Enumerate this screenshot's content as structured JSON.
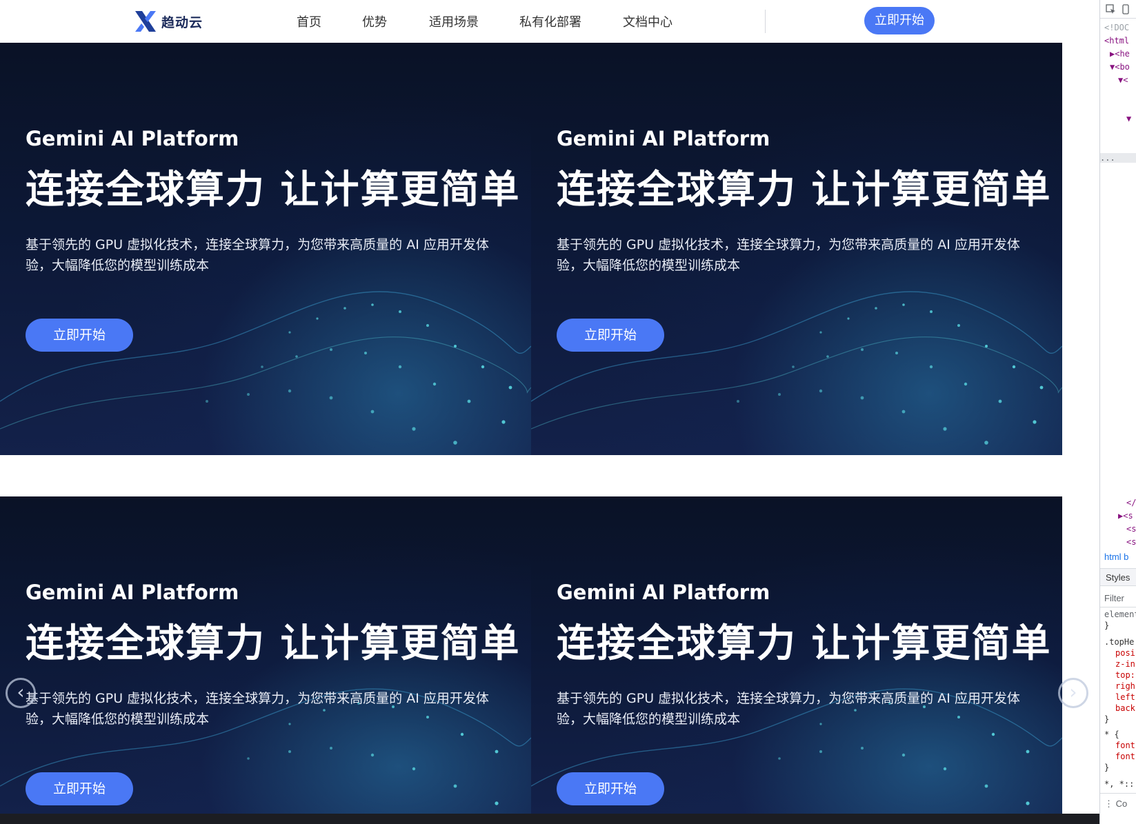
{
  "header": {
    "logo_text": "趋动云",
    "nav": [
      "首页",
      "优势",
      "适用场景",
      "私有化部署",
      "文档中心"
    ],
    "cta_label": "立即开始"
  },
  "hero": {
    "eyebrow": "Gemini AI Platform",
    "headline": "连接全球算力 让计算更简单",
    "description": "基于领先的 GPU 虚拟化技术，连接全球算力，为您带来高质量的 AI 应用开发体验，大幅降低您的模型训练成本",
    "cta_label": "立即开始"
  },
  "carousel": {
    "prev_glyph": "‹",
    "next_glyph": "›"
  },
  "devtools": {
    "lines": [
      "<!DOC",
      "<html",
      "▶<he",
      "▼<bo",
      "▼<",
      "▼",
      "...",
      "</",
      "▶<s",
      "<s",
      "<s"
    ],
    "breadcrumb": "html  b",
    "styles_tab": "Styles",
    "filter_placeholder": "Filter",
    "rules": [
      "element",
      "}",
      ".topHe",
      "posi",
      "z-in",
      "top:",
      "righ",
      "left",
      "back",
      "}",
      "* {",
      "font",
      "font",
      "}",
      "*, *::"
    ],
    "footer": "⋮  Co"
  },
  "colors": {
    "accent": "#4a78f5",
    "hero_bg": "#0c1836",
    "wave": "#58d6e0"
  }
}
